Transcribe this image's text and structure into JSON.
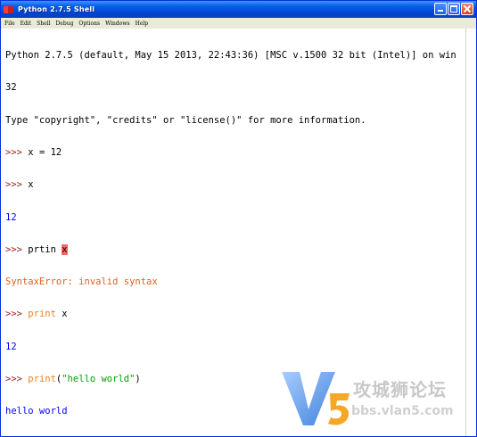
{
  "window": {
    "title": "Python 2.7.5 Shell"
  },
  "menu": {
    "items": [
      "File",
      "Edit",
      "Shell",
      "Debug",
      "Options",
      "Windows",
      "Help"
    ]
  },
  "shell": {
    "banner_line1": "Python 2.7.5 (default, May 15 2013, 22:43:36) [MSC v.1500 32 bit (Intel)] on win",
    "banner_line2": "32",
    "banner_line3": "Type \"copyright\", \"credits\" or \"license()\" for more information.",
    "prompt": ">>> ",
    "cmd1": "x = 12",
    "cmd2": "x",
    "out2": "12",
    "cmd3_pre": "prtin ",
    "cmd3_hl": "x",
    "out3": "SyntaxError: invalid syntax",
    "cmd4_kw": "print",
    "cmd4_rest": " x",
    "out4": "12",
    "cmd5_kw": "print",
    "cmd5_open": "(",
    "cmd5_str": "\"hello world\"",
    "cmd5_close": ")",
    "out5": "hello world",
    "last_prompt": ">>>"
  },
  "watermark": {
    "logo_text": "V5",
    "cn_text": "攻城狮论坛",
    "url_text": "bbs.vlan5.com"
  },
  "colors": {
    "title_bar": "#0046d5",
    "prompt": "#a02020",
    "error": "#e06020",
    "keyword": "#f08020",
    "string": "#00a000",
    "result": "#0000ff",
    "highlight": "#ff6666"
  }
}
